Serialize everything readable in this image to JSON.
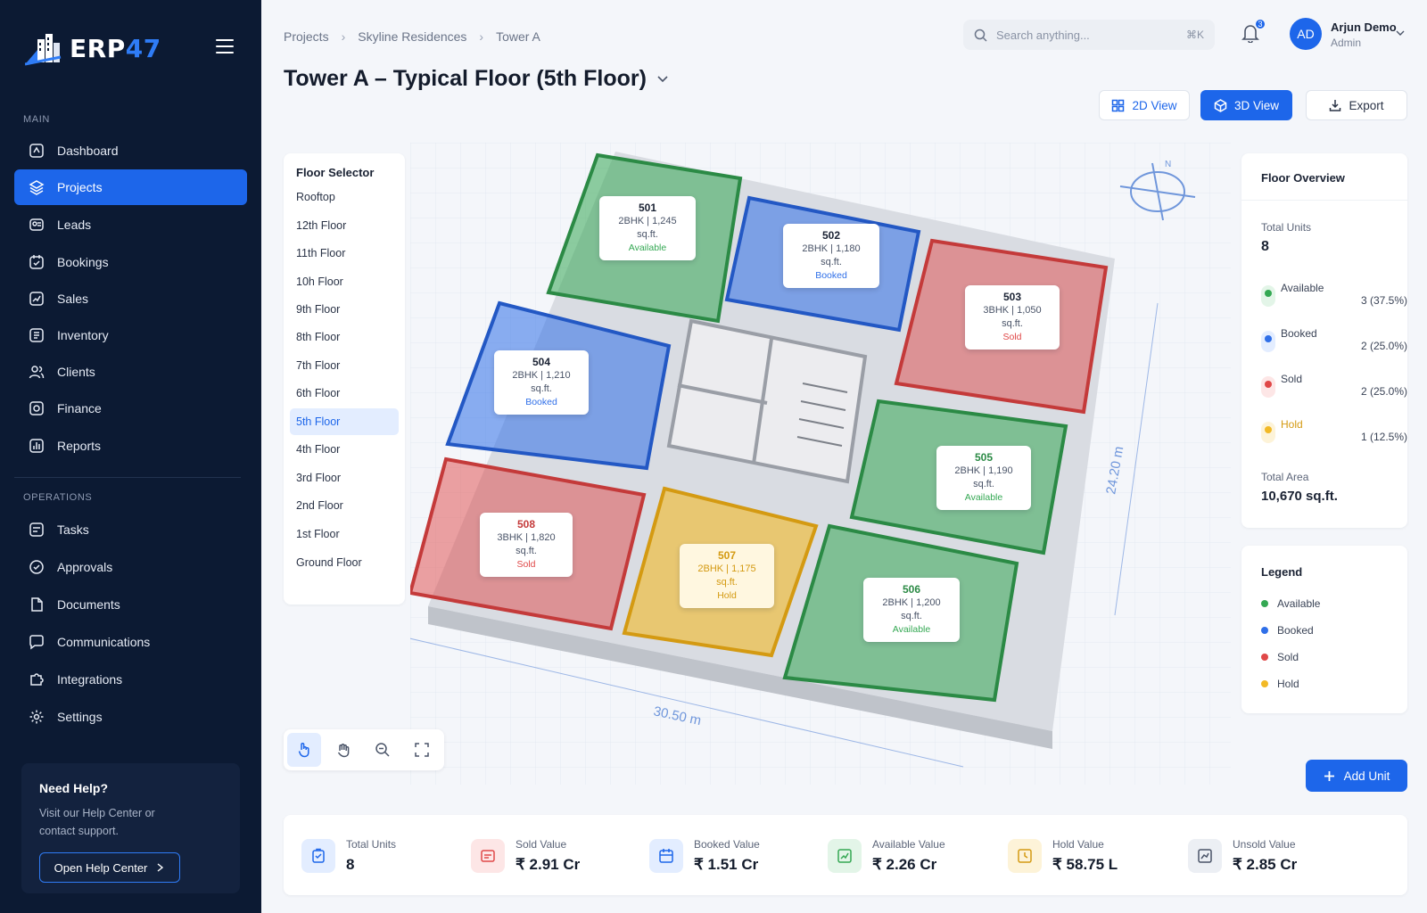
{
  "app": {
    "logo_prefix": "ERP",
    "logo_suffix": "47"
  },
  "sidebar": {
    "main_label": "MAIN",
    "ops_label": "OPERATIONS",
    "main_items": [
      {
        "label": "Dashboard"
      },
      {
        "label": "Projects"
      },
      {
        "label": "Leads"
      },
      {
        "label": "Bookings"
      },
      {
        "label": "Sales"
      },
      {
        "label": "Inventory"
      },
      {
        "label": "Clients"
      },
      {
        "label": "Finance"
      },
      {
        "label": "Reports"
      }
    ],
    "ops_items": [
      {
        "label": "Tasks"
      },
      {
        "label": "Approvals"
      },
      {
        "label": "Documents"
      },
      {
        "label": "Communications"
      },
      {
        "label": "Integrations"
      },
      {
        "label": "Settings"
      }
    ],
    "help": {
      "title": "Need Help?",
      "text": "Visit our Help Center or contact support.",
      "button": "Open Help Center"
    }
  },
  "header": {
    "breadcrumb": [
      "Projects",
      "Skyline Residences",
      "Tower A"
    ],
    "title": "Tower A – Typical Floor (5th Floor)",
    "search_placeholder": "Search anything...",
    "search_shortcut": "⌘K",
    "notifications": "3",
    "user": {
      "initials": "AD",
      "name": "Arjun Demo",
      "role": "Admin"
    },
    "view_2d": "2D View",
    "view_3d": "3D View",
    "export": "Export"
  },
  "floor_selector": {
    "title": "Floor Selector",
    "floors": [
      "Rooftop",
      "12th Floor",
      "11th Floor",
      "10h Floor",
      "9th Floor",
      "8th Floor",
      "7th Floor",
      "6th Floor",
      "5th Floor",
      "4th Floor",
      "3rd Floor",
      "2nd Floor",
      "1st Floor",
      "Ground Floor"
    ],
    "selected": "5th Floor"
  },
  "plan": {
    "dim_width": "30.50 m",
    "dim_depth": "24.20 m",
    "units": [
      {
        "no": "501",
        "info": "2BHK | 1,245 sq.ft.",
        "status": "Available"
      },
      {
        "no": "502",
        "info": "2BHK | 1,180 sq.ft.",
        "status": "Booked"
      },
      {
        "no": "503",
        "info": "3BHK | 1,050 sq.ft.",
        "status": "Sold"
      },
      {
        "no": "504",
        "info": "2BHK | 1,210 sq.ft.",
        "status": "Booked"
      },
      {
        "no": "505",
        "info": "2BHK | 1,190 sq.ft.",
        "status": "Available"
      },
      {
        "no": "506",
        "info": "2BHK | 1,200 sq.ft.",
        "status": "Available"
      },
      {
        "no": "507",
        "info": "2BHK | 1,175 sq.ft.",
        "status": "Hold"
      },
      {
        "no": "508",
        "info": "3BHK | 1,820 sq.ft.",
        "status": "Sold"
      }
    ]
  },
  "overview": {
    "title": "Floor Overview",
    "total_units_label": "Total Units",
    "total_units": "8",
    "rows": [
      {
        "name": "Available",
        "value": "3 (37.5%)"
      },
      {
        "name": "Booked",
        "value": "2 (25.0%)"
      },
      {
        "name": "Sold",
        "value": "2 (25.0%)"
      },
      {
        "name": "Hold",
        "value": "1 (12.5%)"
      }
    ],
    "total_area_label": "Total Area",
    "total_area": "10,670 sq.ft."
  },
  "legend": {
    "title": "Legend",
    "items": [
      "Available",
      "Booked",
      "Sold",
      "Hold"
    ]
  },
  "colors": {
    "available": "#34a853",
    "booked": "#2f6fe8",
    "sold": "#e04848",
    "hold": "#f2b926",
    "accent": "#1d66ea"
  },
  "add_unit": "Add Unit",
  "stats": [
    {
      "label": "Total Units",
      "value": "8"
    },
    {
      "label": "Sold Value",
      "value": "₹ 2.91 Cr"
    },
    {
      "label": "Booked Value",
      "value": "₹ 1.51 Cr"
    },
    {
      "label": "Available Value",
      "value": "₹ 2.26 Cr"
    },
    {
      "label": "Hold Value",
      "value": "₹ 58.75 L"
    },
    {
      "label": "Unsold Value",
      "value": "₹ 2.85 Cr"
    }
  ]
}
